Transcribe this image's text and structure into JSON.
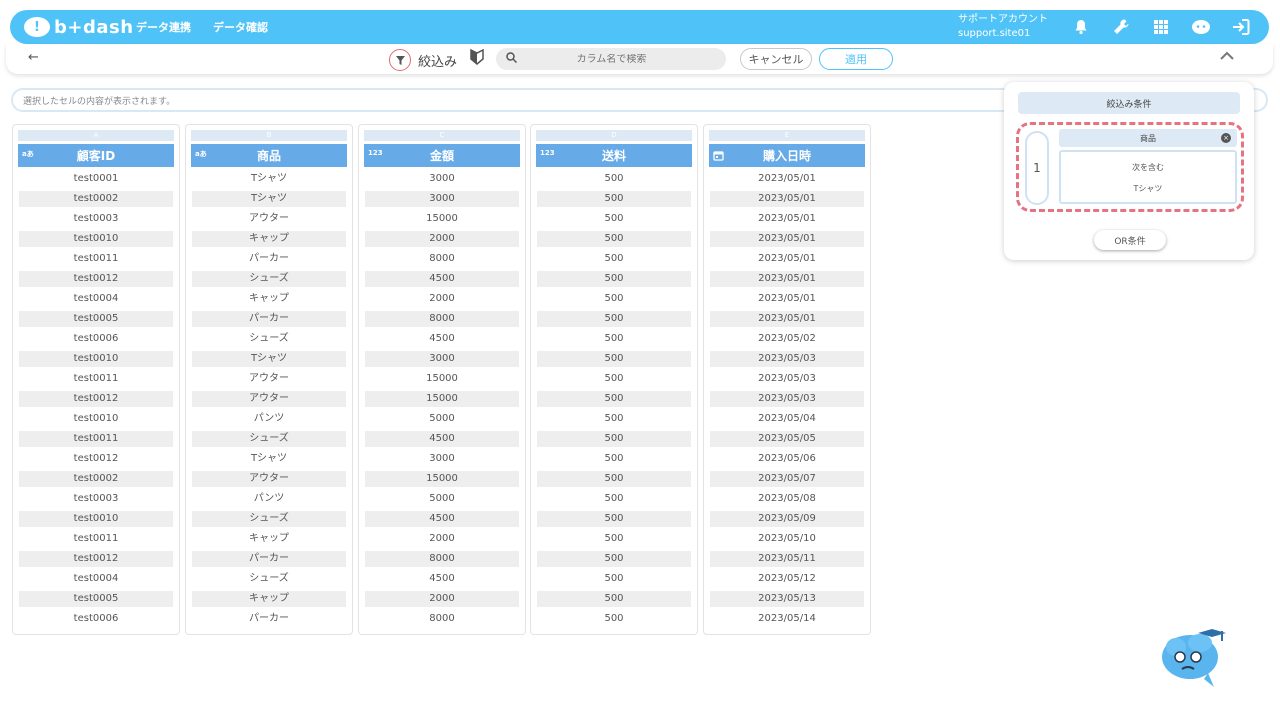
{
  "header": {
    "logo_text": "b+dash",
    "nav": [
      "データ連携",
      "データ確認"
    ],
    "account_name": "サポートアカウント",
    "account_id": "support.site01"
  },
  "toolbar": {
    "filter_label": "絞込み",
    "search_placeholder": "カラム名で検索",
    "cancel_label": "キャンセル",
    "apply_label": "適用"
  },
  "cell_bar": {
    "placeholder": "選択したセルの内容が表示されます。"
  },
  "columns": [
    {
      "letter": "A",
      "type_label": "aあ",
      "header": "顧客ID"
    },
    {
      "letter": "B",
      "type_label": "aあ",
      "header": "商品"
    },
    {
      "letter": "C",
      "type_label": "123",
      "header": "金額"
    },
    {
      "letter": "D",
      "type_label": "123",
      "header": "送料"
    },
    {
      "letter": "E",
      "type_label": "",
      "header": "購入日時"
    }
  ],
  "rows": [
    [
      "test0001",
      "Tシャツ",
      "3000",
      "500",
      "2023/05/01"
    ],
    [
      "test0002",
      "Tシャツ",
      "3000",
      "500",
      "2023/05/01"
    ],
    [
      "test0003",
      "アウター",
      "15000",
      "500",
      "2023/05/01"
    ],
    [
      "test0010",
      "キャップ",
      "2000",
      "500",
      "2023/05/01"
    ],
    [
      "test0011",
      "パーカー",
      "8000",
      "500",
      "2023/05/01"
    ],
    [
      "test0012",
      "シューズ",
      "4500",
      "500",
      "2023/05/01"
    ],
    [
      "test0004",
      "キャップ",
      "2000",
      "500",
      "2023/05/01"
    ],
    [
      "test0005",
      "パーカー",
      "8000",
      "500",
      "2023/05/01"
    ],
    [
      "test0006",
      "シューズ",
      "4500",
      "500",
      "2023/05/02"
    ],
    [
      "test0010",
      "Tシャツ",
      "3000",
      "500",
      "2023/05/03"
    ],
    [
      "test0011",
      "アウター",
      "15000",
      "500",
      "2023/05/03"
    ],
    [
      "test0012",
      "アウター",
      "15000",
      "500",
      "2023/05/03"
    ],
    [
      "test0010",
      "パンツ",
      "5000",
      "500",
      "2023/05/04"
    ],
    [
      "test0011",
      "シューズ",
      "4500",
      "500",
      "2023/05/05"
    ],
    [
      "test0012",
      "Tシャツ",
      "3000",
      "500",
      "2023/05/06"
    ],
    [
      "test0002",
      "アウター",
      "15000",
      "500",
      "2023/05/07"
    ],
    [
      "test0003",
      "パンツ",
      "5000",
      "500",
      "2023/05/08"
    ],
    [
      "test0010",
      "シューズ",
      "4500",
      "500",
      "2023/05/09"
    ],
    [
      "test0011",
      "キャップ",
      "2000",
      "500",
      "2023/05/10"
    ],
    [
      "test0012",
      "パーカー",
      "8000",
      "500",
      "2023/05/11"
    ],
    [
      "test0004",
      "シューズ",
      "4500",
      "500",
      "2023/05/12"
    ],
    [
      "test0005",
      "キャップ",
      "2000",
      "500",
      "2023/05/13"
    ],
    [
      "test0006",
      "パーカー",
      "8000",
      "500",
      "2023/05/14"
    ]
  ],
  "filter_panel": {
    "title": "絞込み条件",
    "condition_number": "1",
    "condition_field": "商品",
    "condition_operator": "次を含む",
    "condition_value": "Tシャツ",
    "or_button": "OR条件"
  }
}
